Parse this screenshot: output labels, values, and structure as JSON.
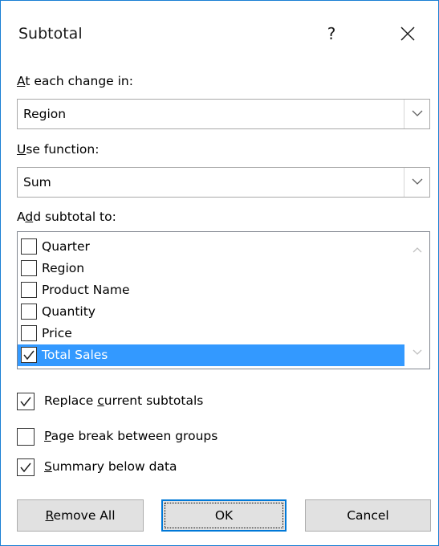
{
  "dialog": {
    "title": "Subtotal",
    "help_label": "?"
  },
  "at_each_change": {
    "label_accel": "A",
    "label_rest": "t each change in:",
    "value": "Region"
  },
  "use_function": {
    "label_accel": "U",
    "label_rest": "se function:",
    "value": "Sum"
  },
  "add_subtotal": {
    "label_pre": "A",
    "label_accel": "d",
    "label_rest": "d subtotal to:",
    "items": [
      {
        "label": "Quarter",
        "checked": false,
        "selected": false
      },
      {
        "label": "Region",
        "checked": false,
        "selected": false
      },
      {
        "label": "Product Name",
        "checked": false,
        "selected": false
      },
      {
        "label": "Quantity",
        "checked": false,
        "selected": false
      },
      {
        "label": "Price",
        "checked": false,
        "selected": false
      },
      {
        "label": "Total Sales",
        "checked": true,
        "selected": true
      }
    ]
  },
  "options": {
    "replace": {
      "pre": "Replace ",
      "accel": "c",
      "rest": "urrent subtotals",
      "checked": true
    },
    "page_break": {
      "pre": "",
      "accel": "P",
      "rest": "age break between groups",
      "checked": false
    },
    "summary": {
      "pre": "",
      "accel": "S",
      "rest": "ummary below data",
      "checked": true
    }
  },
  "buttons": {
    "remove_all": {
      "accel": "R",
      "rest": "emove All"
    },
    "ok": "OK",
    "cancel": "Cancel"
  },
  "colors": {
    "accent": "#0078d7",
    "selection": "#3399ff",
    "button_face": "#e1e1e1"
  }
}
